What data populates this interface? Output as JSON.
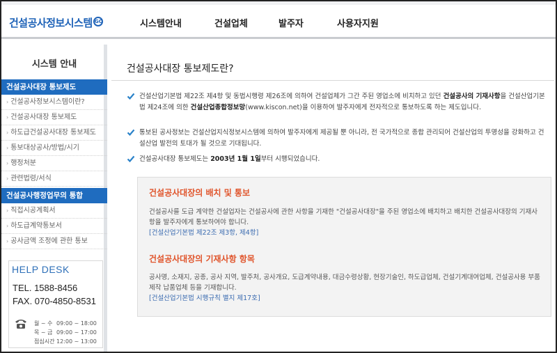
{
  "header": {
    "logo": "건설공사정보시스템",
    "logo_badge": "GO",
    "nav": [
      "시스템안내",
      "건설업체",
      "발주자",
      "사용자지원"
    ]
  },
  "sidebar": {
    "title": "시스템 안내",
    "section1": "건설공사대장 통보제도",
    "section1_items": [
      "건설공사정보시스템이란?",
      "건설공사대장 통보제도",
      "하도급건설공사대장 통보제도",
      "통보대상공사/방법/시기",
      "행정처분",
      "관련법령/서식"
    ],
    "section2": "건설공사행정업무의 통합",
    "section2_items": [
      "직접시공계획서",
      "하도급계약통보서",
      "공사금액 조정에 관한 통보"
    ]
  },
  "helpdesk": {
    "title": "HELP DESK",
    "tel": "TEL. 1588-8456",
    "fax": "FAX. 070-4850-8531",
    "hours": [
      {
        "day": "월 ~ 수",
        "time": "09:00 ~ 18:00"
      },
      {
        "day": "목 ~ 금",
        "time": "09:00 ~ 17:00"
      },
      {
        "day": "점심시간",
        "time": "12:00 ~ 13:00"
      }
    ]
  },
  "main": {
    "title": "건설공사대장 통보제도란?",
    "bullet1_a": "건설산업기본법 제22조 제4항 및 동법시행령 제26조에 의하여 건설업체가 그간 주된 영업소에 비치하고 있던 ",
    "bullet1_b": "건설공사의 기재사항",
    "bullet1_c": "을 건설산업기본법 제24조에 의한 ",
    "bullet1_d": "건설산업종합정보망",
    "bullet1_e": "(www.kiscon.net)을 이용하여 발주자에게 전자적으로 통보하도록 하는 제도입니다.",
    "bullet2": "통보된 공사정보는 건설산업지식정보시스템에 의하여 발주자에게 제공될 뿐 아니라, 전 국가적으로 종합 관리되어 건설산업의 투명성을 강화하고 건설산업 발전의 토대가 될 것으로 기대됩니다.",
    "bullet3_a": "건설공사대장 통보제도는 ",
    "bullet3_b": "2003년 1월 1일",
    "bullet3_c": "부터 시행되었습니다.",
    "box": {
      "title1": "건설공사대장의 배치 및 통보",
      "body1": "건설공사를 도급 계약한 건설업자는 건설공사에 관한 사항을 기재한 \"건설공사대장\"을 주된 영업소에 배치하고 배치한 건설공사대장의 기재사항을 발주자에게 통보하여야 합니다.",
      "link1": "[건설산업기본법 제22조 제3항, 제4항]",
      "title2": "건설공사대장의 기재사항 항목",
      "body2": "공사명, 소재지, 공종, 공사 지역, 발주처, 공사개요, 도급계약내용, 대금수령상황, 현장기술인, 하도급업체, 건설기계대여업체, 건설공사용 부품제작 납품업체 등을 기재합니다.",
      "link2": "[건설산업기본법 시행규칙 별지 제17호]"
    }
  },
  "colors": {
    "brand_blue": "#1f63b8",
    "section_blue": "#1f6cbf",
    "accent_orange": "#e0542b",
    "check_blue": "#2a82c9"
  }
}
